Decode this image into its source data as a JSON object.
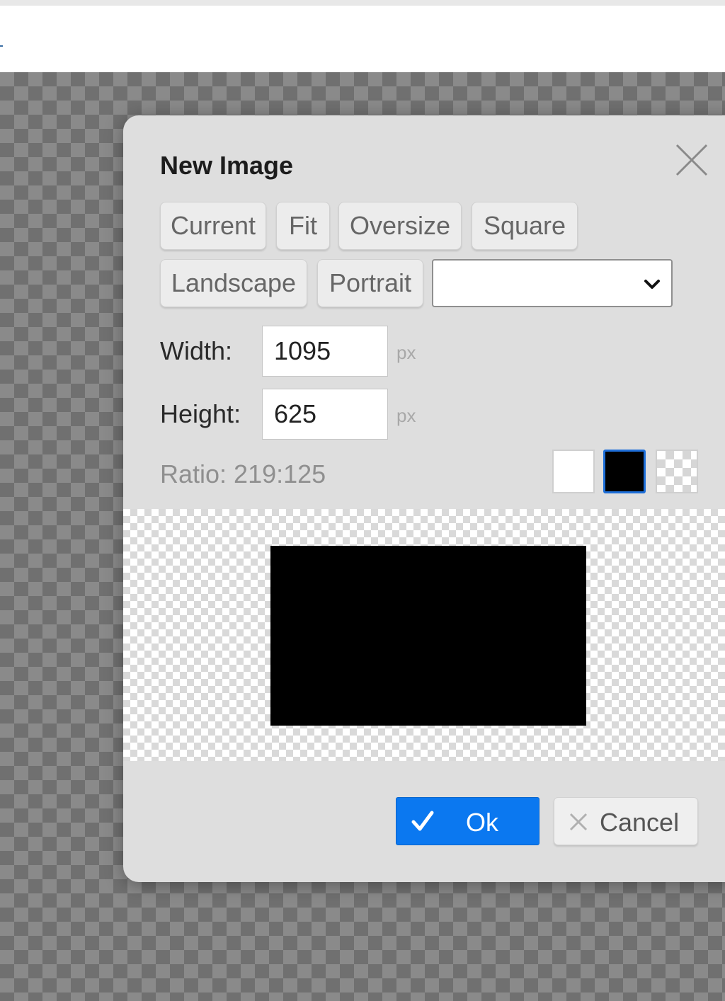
{
  "dialog": {
    "title": "New Image",
    "presets": [
      "Current",
      "Fit",
      "Oversize",
      "Square",
      "Landscape",
      "Portrait"
    ],
    "preset_select_value": "",
    "width_label": "Width:",
    "width_value": "1095",
    "height_label": "Height:",
    "height_value": "625",
    "unit": "px",
    "ratio": "Ratio: 219:125",
    "background_options": [
      "white",
      "black",
      "transparent"
    ],
    "selected_background": "black",
    "ok_label": "Ok",
    "cancel_label": "Cancel",
    "colors": {
      "accent": "#0b78f0",
      "selected_swatch_border": "#1e6fd9",
      "dialog_bg": "#dedede"
    },
    "icons": {
      "close": "close-icon",
      "ok": "check-icon",
      "cancel": "x-icon",
      "select": "chevron-down-icon"
    }
  }
}
